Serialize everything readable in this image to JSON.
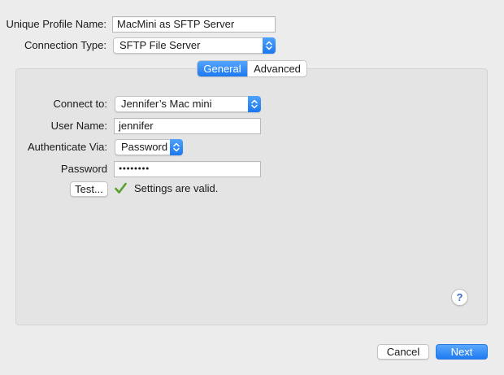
{
  "form": {
    "unique_profile_name_label": "Unique Profile Name:",
    "unique_profile_name_value": "MacMini as SFTP Server",
    "connection_type_label": "Connection Type:",
    "connection_type_value": "SFTP File Server"
  },
  "tabs": [
    {
      "label": "General",
      "selected": true
    },
    {
      "label": "Advanced",
      "selected": false
    }
  ],
  "general": {
    "connect_to_label": "Connect to:",
    "connect_to_value": "Jennifer’s Mac mini",
    "user_name_label": "User Name:",
    "user_name_value": "jennifer",
    "authenticate_via_label": "Authenticate Via:",
    "authenticate_via_value": "Password",
    "password_label": "Password",
    "password_value": "●●●●●●●●",
    "test_button_label": "Test...",
    "status_text": "Settings are valid.",
    "status_icon": "checkmark-icon"
  },
  "help": {
    "label": "?"
  },
  "footer": {
    "cancel_label": "Cancel",
    "next_label": "Next"
  },
  "colors": {
    "accent": "#1d79f1",
    "check": "#5aa02c",
    "window_bg": "#ececec",
    "panel_bg": "#e4e4e4"
  }
}
